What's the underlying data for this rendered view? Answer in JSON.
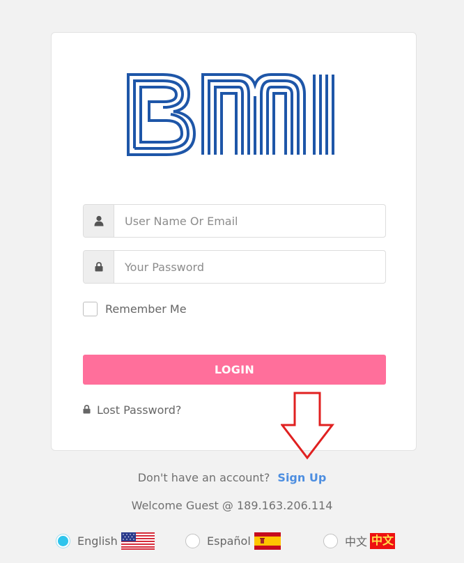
{
  "logo": {
    "text": "BMI",
    "color": "#1e56a8"
  },
  "form": {
    "username_placeholder": "User Name Or Email",
    "password_placeholder": "Your Password",
    "remember_label": "Remember Me",
    "remember_checked": false,
    "login_label": "LOGIN",
    "lost_password_label": "Lost Password?"
  },
  "icons": {
    "username": "user-icon",
    "password": "lock-icon",
    "lost_password": "lock-icon",
    "annotation": "down-arrow-icon"
  },
  "signup": {
    "prompt": "Don't have an account?",
    "link": "Sign Up"
  },
  "welcome": "Welcome Guest @ 189.163.206.114",
  "languages": [
    {
      "label": "English",
      "selected": true,
      "flag": "us-flag"
    },
    {
      "label": "Español",
      "selected": false,
      "flag": "spain-flag"
    },
    {
      "label": "中文",
      "selected": false,
      "flag_text": "中文"
    }
  ],
  "colors": {
    "accent": "#ff6f9b",
    "link": "#4d8ee0",
    "radio_selected": "#2ec4ec",
    "annotation_arrow": "#e02020"
  }
}
